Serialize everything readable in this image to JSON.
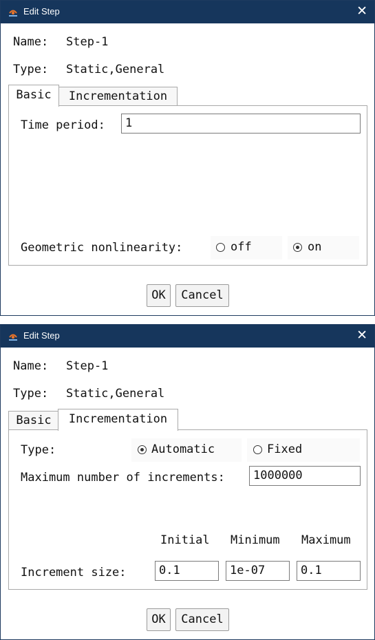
{
  "dialog1": {
    "title": "Edit Step",
    "close_glyph": "✕",
    "name_label": "Name:",
    "name_value": "Step-1",
    "type_label": "Type:",
    "type_value": "Static,General",
    "tabs": [
      "Basic",
      "Incrementation"
    ],
    "active_tab": "Basic",
    "basic": {
      "time_period_label": "Time period:",
      "time_period_value": "1",
      "nlgeom_label": "Geometric nonlinearity:",
      "nlgeom_options": [
        "off",
        "on"
      ],
      "nlgeom_selected": "on"
    },
    "ok_label": "OK",
    "cancel_label": "Cancel"
  },
  "dialog2": {
    "title": "Edit Step",
    "close_glyph": "✕",
    "name_label": "Name:",
    "name_value": "Step-1",
    "type_label": "Type:",
    "type_value": "Static,General",
    "tabs": [
      "Basic",
      "Incrementation"
    ],
    "active_tab": "Incrementation",
    "incrementation": {
      "type_label": "Type:",
      "type_options": [
        "Automatic",
        "Fixed"
      ],
      "type_selected": "Automatic",
      "max_increments_label": "Maximum number of increments:",
      "max_increments_value": "1000000",
      "col_headers": [
        "Initial",
        "Minimum",
        "Maximum"
      ],
      "increment_size_label": "Increment size:",
      "initial_value": "0.1",
      "minimum_value": "1e-07",
      "maximum_value": "0.1"
    },
    "ok_label": "OK",
    "cancel_label": "Cancel"
  },
  "icons": {
    "app": "app-logo-icon",
    "close": "close-icon"
  },
  "colors": {
    "titlebar": "#16365c",
    "border": "#a9a9a9"
  }
}
